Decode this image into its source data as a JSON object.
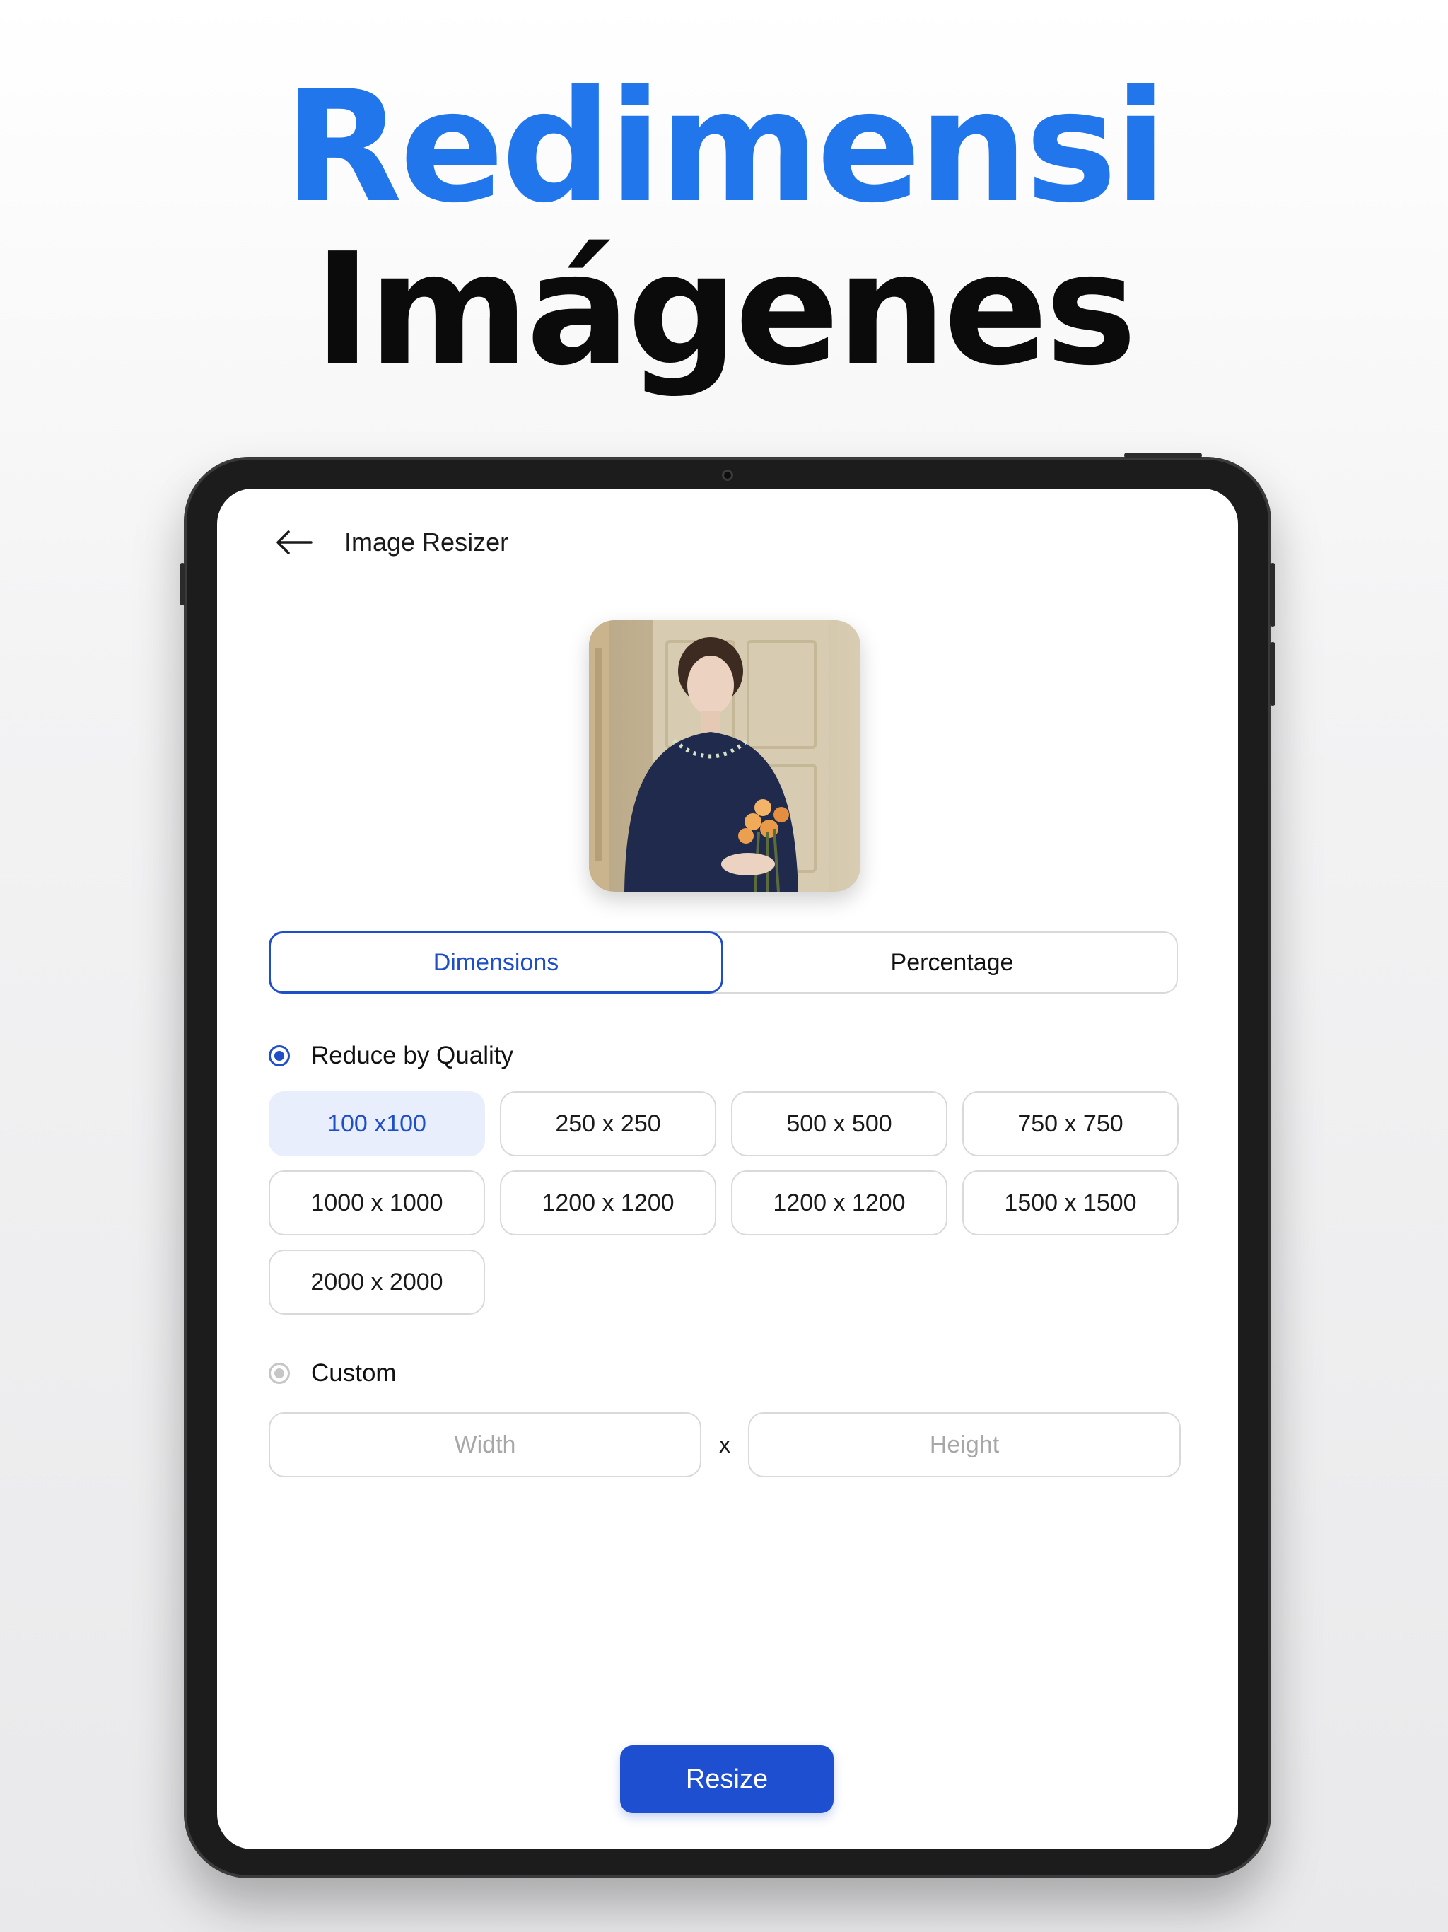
{
  "headline": {
    "line1": "Redimensi",
    "line2": "Imágenes"
  },
  "app": {
    "title": "Image Resizer",
    "back_icon": "arrow-left-icon"
  },
  "tabs": {
    "active": "Dimensions",
    "inactive": "Percentage"
  },
  "quality": {
    "label": "Reduce by Quality",
    "options": [
      "100 x100",
      "250 x 250",
      "500 x 500",
      "750 x 750",
      "1000 x 1000",
      "1200 x 1200",
      "1200 x 1200",
      "1500 x 1500",
      "2000 x 2000"
    ],
    "selected_index": 0
  },
  "custom": {
    "label": "Custom",
    "width_placeholder": "Width",
    "separator": "x",
    "height_placeholder": "Height"
  },
  "actions": {
    "resize_label": "Resize"
  },
  "colors": {
    "headline_blue": "#2176ec",
    "accent": "#1f4fc7",
    "button": "#1f4fd1",
    "chip_selected_bg": "#e8eefb"
  }
}
